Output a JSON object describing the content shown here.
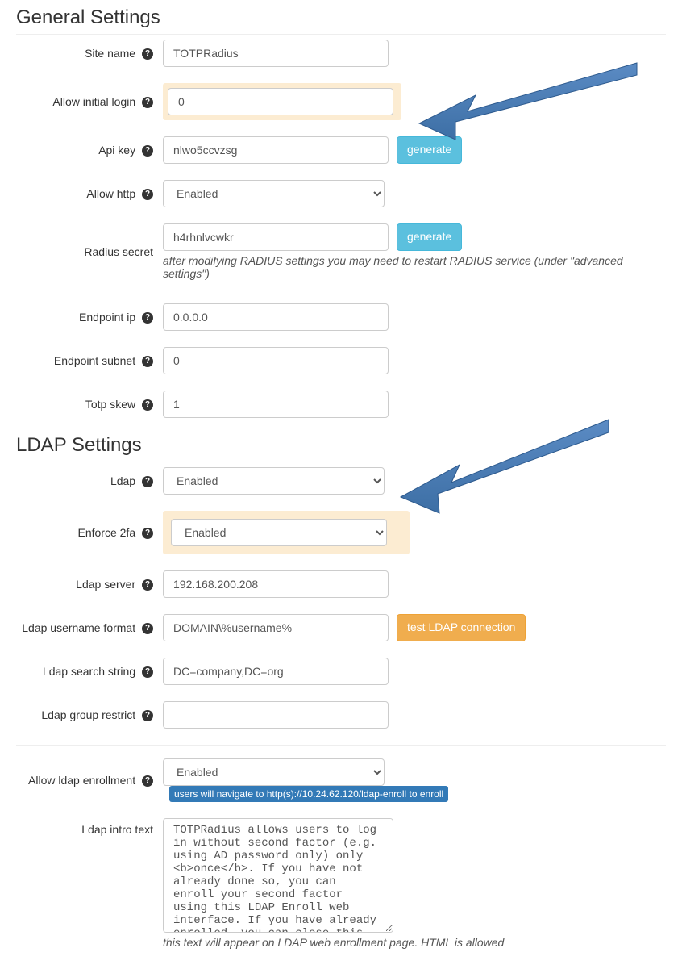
{
  "general": {
    "title": "General Settings",
    "site_name_label": "Site name",
    "site_name": "TOTPRadius",
    "allow_initial_label": "Allow initial login",
    "allow_initial": "0",
    "api_key_label": "Api key",
    "api_key": "nlwo5ccvzsg",
    "generate": "generate",
    "allow_http_label": "Allow http",
    "allow_http": "Enabled",
    "radius_secret_label": "Radius secret",
    "radius_secret": "h4rhnlvcwkr",
    "radius_help": "after modifying RADIUS settings you may need to restart RADIUS service (under \"advanced settings\")",
    "endpoint_ip_label": "Endpoint ip",
    "endpoint_ip": "0.0.0.0",
    "endpoint_subnet_label": "Endpoint subnet",
    "endpoint_subnet": "0",
    "totp_skew_label": "Totp skew",
    "totp_skew": "1"
  },
  "ldap": {
    "title": "LDAP Settings",
    "ldap_label": "Ldap",
    "ldap_value": "Enabled",
    "enforce_label": "Enforce 2fa",
    "enforce_value": "Enabled",
    "server_label": "Ldap server",
    "server": "192.168.200.208",
    "user_fmt_label": "Ldap username format",
    "user_fmt": "DOMAIN\\%username%",
    "test_btn": "test LDAP connection",
    "search_label": "Ldap search string",
    "search": "DC=company,DC=org",
    "group_restrict_label": "Ldap group restrict",
    "group_restrict": "",
    "enroll_label": "Allow ldap enrollment",
    "enroll_value": "Enabled",
    "enroll_badge": "users will navigate to http(s)://10.24.62.120/ldap-enroll to enroll",
    "intro_label": "Ldap intro text",
    "intro_text": "TOTPRadius allows users to log in without second factor (e.g. using AD password only) only <b>once</b>. If you have not already done so, you can enroll your second factor using this LDAP Enroll web interface. If you have already enrolled, you can close this page.",
    "intro_help": "this text will appear on LDAP web enrollment page. HTML is allowed"
  }
}
